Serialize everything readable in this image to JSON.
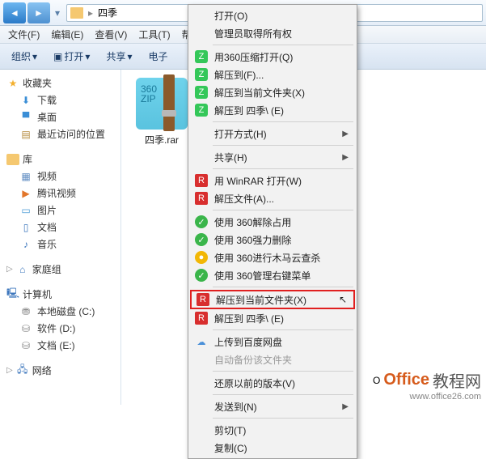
{
  "nav": {
    "path_label": "四季"
  },
  "menubar": {
    "file": "文件(F)",
    "edit": "编辑(E)",
    "view": "查看(V)",
    "tools": "工具(T)",
    "help": "帮助(H)"
  },
  "toolbar": {
    "organize": "组织",
    "open": "打开",
    "share": "共享",
    "email": "电子"
  },
  "sidebar": {
    "favorites": {
      "header": "收藏夹",
      "items": [
        "下载",
        "桌面",
        "最近访问的位置"
      ]
    },
    "libraries": {
      "header": "库",
      "items": [
        "视频",
        "腾讯视频",
        "图片",
        "文档",
        "音乐"
      ]
    },
    "homegroup": {
      "header": "家庭组"
    },
    "computer": {
      "header": "计算机",
      "items": [
        "本地磁盘 (C:)",
        "软件 (D:)",
        "文档 (E:)"
      ]
    },
    "network": {
      "header": "网络"
    }
  },
  "content": {
    "file_name": "四季.rar",
    "archive_badge_top": "360",
    "archive_badge_bottom": "ZIP"
  },
  "context_menu": {
    "open": "打开(O)",
    "admin": "管理员取得所有权",
    "open360": "用360压缩打开(Q)",
    "extract_to": "解压到(F)...",
    "extract_here": "解压到当前文件夹(X)",
    "extract_to_folder": "解压到 四季\\ (E)",
    "open_with": "打开方式(H)",
    "share": "共享(H)",
    "winrar_open": "用 WinRAR 打开(W)",
    "extract_files": "解压文件(A)...",
    "unlock360": "使用 360解除占用",
    "forcedelete360": "使用 360强力删除",
    "trojanscan360": "使用 360进行木马云查杀",
    "manage360": "使用 360管理右键菜单",
    "extract_here2": "解压到当前文件夹(X)",
    "extract_to_folder2": "解压到 四季\\ (E)",
    "baidu_upload": "上传到百度网盘",
    "auto_backup": "自动备份该文件夹",
    "restore_prev": "还原以前的版本(V)",
    "send_to": "发送到(N)",
    "cut": "剪切(T)",
    "copy": "复制(C)"
  },
  "watermark": {
    "brand1": "Office",
    "brand2": "教程网",
    "url": "www.office26.com"
  }
}
